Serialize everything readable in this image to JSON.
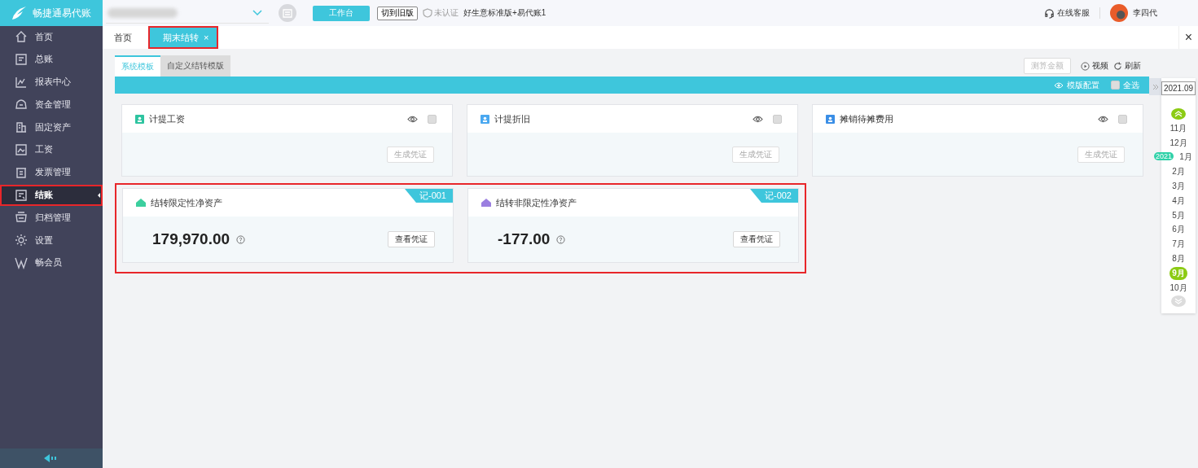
{
  "app": {
    "logo": "畅捷通易代账"
  },
  "topbar": {
    "workbench_button": "工作台",
    "switch_button": "切到旧版",
    "cert_status": "未认证",
    "product": "好生意标准版+易代账1",
    "support": "在线客服",
    "user": "李四代"
  },
  "sidebar": {
    "items": [
      {
        "label": "首页",
        "selected": false,
        "highlighted": false
      },
      {
        "label": "总账",
        "selected": false,
        "highlighted": false
      },
      {
        "label": "报表中心",
        "selected": false,
        "highlighted": false
      },
      {
        "label": "资金管理",
        "selected": false,
        "highlighted": false
      },
      {
        "label": "固定资产",
        "selected": false,
        "highlighted": false
      },
      {
        "label": "工资",
        "selected": false,
        "highlighted": false
      },
      {
        "label": "发票管理",
        "selected": false,
        "highlighted": false
      },
      {
        "label": "结账",
        "selected": true,
        "highlighted": true
      },
      {
        "label": "归档管理",
        "selected": false,
        "highlighted": false
      },
      {
        "label": "设置",
        "selected": false,
        "highlighted": false
      },
      {
        "label": "畅会员",
        "selected": false,
        "highlighted": false
      }
    ]
  },
  "tabs": [
    {
      "label": "首页",
      "selected": false,
      "highlighted": false
    },
    {
      "label": "期末结转",
      "selected": true,
      "close": "×",
      "highlighted": true
    }
  ],
  "close_all": "×",
  "subtabs": [
    {
      "label": "系统模板",
      "selected": true
    },
    {
      "label": "自定义结转模版",
      "selected": false
    }
  ],
  "toolbar": {
    "calc_button": "测算金额",
    "calc_disabled": true,
    "video": "视频",
    "refresh": "刷新"
  },
  "banner": {
    "config": "模版配置",
    "select_all": "全选",
    "select_all_checked": false
  },
  "cards": [
    {
      "title": "计提工资",
      "color": "#2ec4a0",
      "checked": false,
      "button": "生成凭证"
    },
    {
      "title": "计提折旧",
      "color": "#4aa8f0",
      "checked": false,
      "button": "生成凭证"
    },
    {
      "title": "摊销待摊费用",
      "color": "#3a8ee6",
      "checked": false,
      "button": "生成凭证"
    }
  ],
  "closing_section": {
    "highlighted": true,
    "cards": [
      {
        "title": "结转限定性净资产",
        "color": "#3ccf9e",
        "badge": "记-001",
        "amount": "179,970.00",
        "button": "查看凭证"
      },
      {
        "title": "结转非限定性净资产",
        "color": "#9b7fe0",
        "badge": "记-002",
        "amount": "-177.00",
        "button": "查看凭证"
      }
    ]
  },
  "calendar": {
    "period": "2021.09",
    "months": [
      {
        "label": "11月",
        "selected": false
      },
      {
        "label": "12月",
        "selected": false
      },
      {
        "label": "1月",
        "selected": false,
        "year_badge": "2021"
      },
      {
        "label": "2月",
        "selected": false
      },
      {
        "label": "3月",
        "selected": false
      },
      {
        "label": "4月",
        "selected": false
      },
      {
        "label": "5月",
        "selected": false
      },
      {
        "label": "6月",
        "selected": false
      },
      {
        "label": "7月",
        "selected": false
      },
      {
        "label": "8月",
        "selected": false
      },
      {
        "label": "9月",
        "selected": true
      },
      {
        "label": "10月",
        "selected": false
      }
    ]
  }
}
